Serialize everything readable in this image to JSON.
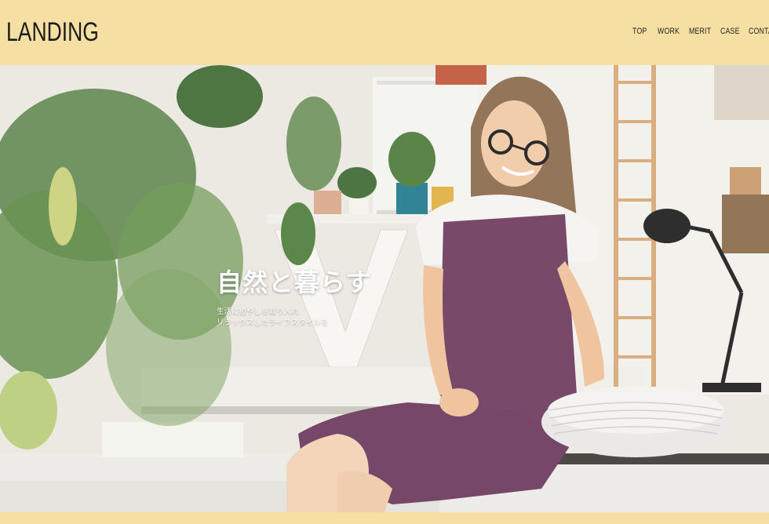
{
  "header": {
    "logo": "LANDING",
    "nav": [
      "TOP",
      "WORK",
      "MERIT",
      "CASE",
      "CONTA"
    ]
  },
  "hero": {
    "title": "自然と暮らす",
    "subtitle_line1": "生活に癒やしを取り入れ",
    "subtitle_line2": "リラックスしたライフスタイルを"
  },
  "colors": {
    "header_bg": "#f6dfa3",
    "dress": "#6e3a5e"
  }
}
